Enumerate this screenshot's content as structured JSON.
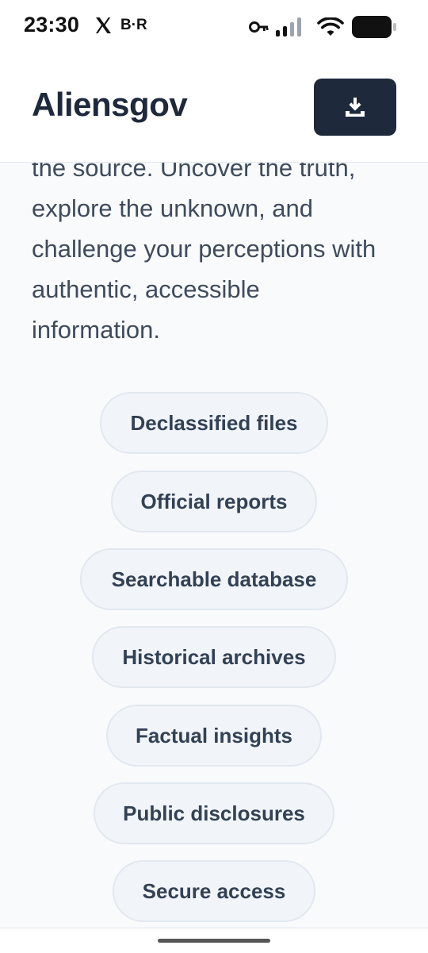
{
  "status_bar": {
    "time": "23:30",
    "notification_label": "B·R",
    "icons": [
      "x-logo-icon",
      "key-icon",
      "signal-icon",
      "wifi-icon",
      "battery-icon"
    ]
  },
  "header": {
    "brand": "Aliensgov",
    "download_icon": "download-icon"
  },
  "intro": {
    "lines": [
      "the source. Uncover the truth,",
      "explore the unknown, and",
      "challenge your perceptions with",
      "authentic, accessible",
      "information."
    ]
  },
  "features": [
    "Declassified files",
    "Official reports",
    "Searchable database",
    "Historical archives",
    "Factual insights",
    "Public disclosures",
    "Secure access"
  ],
  "colors": {
    "accent": "#1e293b",
    "background": "#f8fafc",
    "chip_bg": "#f1f5f9",
    "chip_border": "#e2e8f0"
  }
}
